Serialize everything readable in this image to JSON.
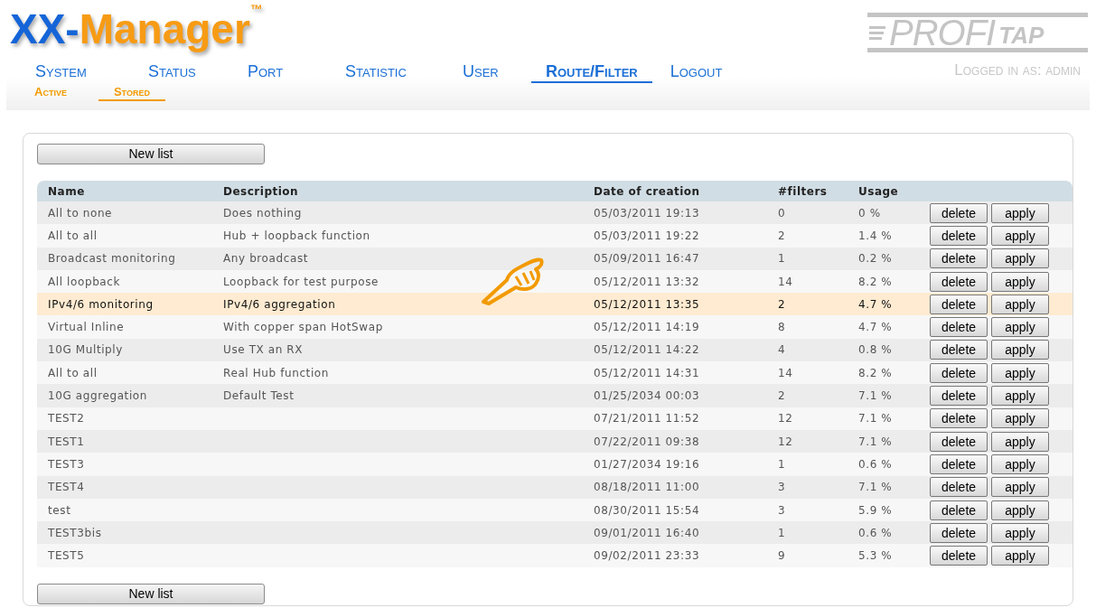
{
  "logo": {
    "prefix": "XX-",
    "name": "Manager",
    "trademark": "™"
  },
  "brand_logo": {
    "text": "PROFI",
    "suffix": "TAP"
  },
  "nav": [
    {
      "label": "System",
      "selected": false
    },
    {
      "label": "Status",
      "selected": false
    },
    {
      "label": "Port",
      "selected": false
    },
    {
      "label": "Statistic",
      "selected": false
    },
    {
      "label": "User",
      "selected": false
    },
    {
      "label": "Route/Filter",
      "selected": true
    },
    {
      "label": "Logout",
      "selected": false
    }
  ],
  "login_status": "Logged in as: admin",
  "subnav": [
    {
      "label": "Active",
      "selected": false
    },
    {
      "label": "Stored",
      "selected": true
    }
  ],
  "new_list_button": "New list",
  "table": {
    "columns": [
      "Name",
      "Description",
      "Date of creation",
      "#filters",
      "Usage"
    ],
    "rows": [
      {
        "name": "All to none",
        "description": "Does nothing",
        "date": "05/03/2011 19:13",
        "filters": "0",
        "usage": "0 %",
        "highlighted": false,
        "actions": [
          "delete",
          "apply"
        ]
      },
      {
        "name": "All to all",
        "description": "Hub + loopback function",
        "date": "05/03/2011 19:22",
        "filters": "2",
        "usage": "1.4 %",
        "highlighted": false,
        "actions": [
          "delete",
          "apply"
        ]
      },
      {
        "name": "Broadcast monitoring",
        "description": "Any broadcast",
        "date": "05/09/2011 16:47",
        "filters": "1",
        "usage": "0.2 %",
        "highlighted": false,
        "actions": [
          "delete",
          "apply"
        ]
      },
      {
        "name": "All loopback",
        "description": "Loopback for test purpose",
        "date": "05/12/2011 13:32",
        "filters": "14",
        "usage": "8.2 %",
        "highlighted": false,
        "actions": [
          "delete",
          "apply"
        ]
      },
      {
        "name": "IPv4/6 monitoring",
        "description": "IPv4/6 aggregation",
        "date": "05/12/2011 13:35",
        "filters": "2",
        "usage": "4.7 %",
        "highlighted": true,
        "actions": [
          "delete",
          "apply"
        ]
      },
      {
        "name": "Virtual Inline",
        "description": "With copper span HotSwap",
        "date": "05/12/2011 14:19",
        "filters": "8",
        "usage": "4.7 %",
        "highlighted": false,
        "actions": [
          "delete",
          "apply"
        ]
      },
      {
        "name": "10G Multiply",
        "description": "Use TX an RX",
        "date": "05/12/2011 14:22",
        "filters": "4",
        "usage": "0.8 %",
        "highlighted": false,
        "actions": [
          "delete",
          "apply"
        ]
      },
      {
        "name": "All to all",
        "description": "Real Hub function",
        "date": "05/12/2011 14:31",
        "filters": "14",
        "usage": "8.2 %",
        "highlighted": false,
        "actions": [
          "delete",
          "apply"
        ]
      },
      {
        "name": "10G aggregation",
        "description": "Default Test",
        "date": "01/25/2034 00:03",
        "filters": "2",
        "usage": "7.1 %",
        "highlighted": false,
        "actions": [
          "delete",
          "apply"
        ]
      },
      {
        "name": "TEST2",
        "date": "07/21/2011 11:52",
        "filters": "12",
        "usage": "7.1 %",
        "highlighted": false,
        "actions": [
          "delete",
          "apply"
        ]
      },
      {
        "name": "TEST1",
        "date": "07/22/2011 09:38",
        "filters": "12",
        "usage": "7.1 %",
        "highlighted": false,
        "actions": [
          "delete",
          "apply"
        ]
      },
      {
        "name": "TEST3",
        "date": "01/27/2034 19:16",
        "filters": "1",
        "usage": "0.6 %",
        "highlighted": false,
        "actions": [
          "delete",
          "apply"
        ]
      },
      {
        "name": "TEST4",
        "date": "08/18/2011 11:00",
        "filters": "3",
        "usage": "7.1 %",
        "highlighted": false,
        "actions": [
          "delete",
          "apply"
        ]
      },
      {
        "name": "test",
        "date": "08/30/2011 15:54",
        "filters": "3",
        "usage": "5.9 %",
        "highlighted": false,
        "actions": [
          "delete",
          "apply"
        ]
      },
      {
        "name": "TEST3bis",
        "date": "09/01/2011 16:40",
        "filters": "1",
        "usage": "0.6 %",
        "highlighted": false,
        "actions": [
          "delete",
          "apply"
        ]
      },
      {
        "name": "TEST5",
        "date": "09/02/2011 23:33",
        "filters": "9",
        "usage": "5.3 %",
        "highlighted": false,
        "actions": [
          "delete",
          "apply"
        ]
      }
    ]
  },
  "new_list_button_bottom": "New list"
}
